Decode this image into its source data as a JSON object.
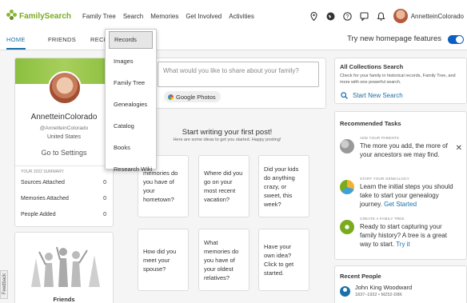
{
  "nav": {
    "logo_text": "FamilySearch",
    "items": [
      "Family Tree",
      "Search",
      "Memories",
      "Get Involved",
      "Activities"
    ],
    "username": "AnnetteinColorado",
    "icons": [
      "location-pin-icon",
      "globe-icon",
      "help-icon",
      "messages-icon",
      "bell-icon"
    ]
  },
  "tabs": [
    "HOME",
    "FRIENDS",
    "RECEI"
  ],
  "try_new": "Try new homepage features",
  "dropdown": [
    "Records",
    "Images",
    "Family Tree",
    "Genealogies",
    "Catalog",
    "Books",
    "Research Wiki"
  ],
  "profile": {
    "name": "AnnetteinColorado",
    "handle": "@AnnetteinColorado",
    "country": "United States",
    "settings": "Go to Settings",
    "summary_heading": "YOUR 2022 SUMMARY",
    "summary": [
      {
        "label": "Sources Attached",
        "value": "0"
      },
      {
        "label": "Memories Attached",
        "value": "0"
      },
      {
        "label": "People Added",
        "value": "0"
      }
    ]
  },
  "friends": {
    "title": "Friends"
  },
  "composer": {
    "placeholder": "What would you like to share about your family?",
    "google_photos": "Google Photos"
  },
  "start": {
    "title": "Start writing your first post!",
    "subtitle": "Here are some ideas to get you started. Happy posting!"
  },
  "prompts": [
    "memories do you have of your hometown?",
    "Where did you go on your most recent vacation?",
    "Did your kids do anything crazy, or sweet, this week?",
    "How did you meet your spouse?",
    "What memories do you have of your oldest relatives?",
    "Have your own idea? Click to get started."
  ],
  "all_collections": {
    "title": "All Collections Search",
    "desc": "Check for your family in historical records, Family Tree, and more with one powerful search.",
    "link": "Start New Search"
  },
  "recommended": {
    "title": "Recommended Tasks",
    "tasks": [
      {
        "label": "ADD YOUR PARENTS",
        "text": "The more you add, the more of your ancestors we may find.",
        "link": ""
      },
      {
        "label": "START YOUR GENEALOGY",
        "text": "Learn the initial steps you should take to start your genealogy journey.",
        "link": "Get Started"
      },
      {
        "label": "CREATE A FAMILY TREE",
        "text": "Ready to start capturing your family history? A tree is a great way to start.",
        "link": "Try it"
      }
    ]
  },
  "recent_people": {
    "title": "Recent People",
    "people": [
      {
        "name": "John King Woodward",
        "dates": "1837–1932 • MZ52-D8K"
      }
    ]
  },
  "feedback": "Feedback",
  "colors": {
    "accent": "#1a6fa8",
    "brand_green": "#8bbf3f",
    "toggle": "#0d5ec1"
  }
}
